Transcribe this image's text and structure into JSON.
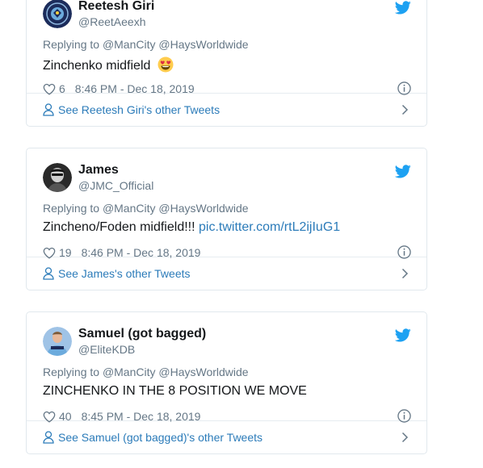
{
  "colors": {
    "twitter_blue": "#1da1f2",
    "link_blue": "#2b7bb9",
    "secondary_text": "#657786",
    "primary_text": "#14171a",
    "border": "#e1e8ed"
  },
  "tweets": [
    {
      "author_name": "Reetesh Giri",
      "author_handle": "@ReetAeexh",
      "replying_prefix": "Replying to",
      "replying_to": [
        "@ManCity",
        "@HaysWorldwide"
      ],
      "text": "Zinchenko midfield",
      "emoji": "heart-eyes-emoji",
      "link": "",
      "likes": "6",
      "timestamp": "8:46 PM - Dec 18, 2019",
      "footer_label": "See Reetesh Giri's other Tweets",
      "avatar": "man-city-crest-avatar"
    },
    {
      "author_name": "James",
      "author_handle": "@JMC_Official",
      "replying_prefix": "Replying to",
      "replying_to": [
        "@ManCity",
        "@HaysWorldwide"
      ],
      "text": "Zincheno/Foden midfield!!!",
      "emoji": "",
      "link": "pic.twitter.com/rtL2ijIuG1",
      "likes": "19",
      "timestamp": "8:46 PM - Dec 18, 2019",
      "footer_label": "See James's other Tweets",
      "avatar": "portrait-avatar"
    },
    {
      "author_name": "Samuel (got bagged)",
      "author_handle": "@EliteKDB",
      "replying_prefix": "Replying to",
      "replying_to": [
        "@ManCity",
        "@HaysWorldwide"
      ],
      "text": "ZINCHENKO IN THE 8 POSITION WE MOVE",
      "emoji": "",
      "link": "",
      "likes": "40",
      "timestamp": "8:45 PM - Dec 18, 2019",
      "footer_label": "See Samuel (got bagged)'s other Tweets",
      "avatar": "player-photo-avatar"
    }
  ]
}
